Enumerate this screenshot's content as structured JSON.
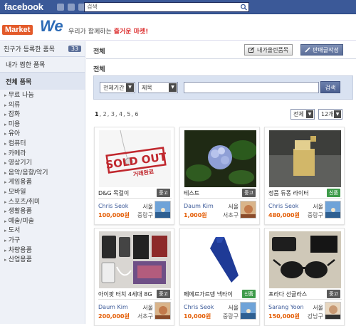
{
  "facebook": {
    "logo": "facebook",
    "search_placeholder": "검색"
  },
  "brand": {
    "market": "Market",
    "we": "We",
    "slogan_prefix": "우리가 함께하는 ",
    "slogan_highlight": "즐거운 마켓!"
  },
  "sidebar": {
    "friends_label": "친구가 등록한 품목",
    "friends_count": "33",
    "my_liked": "내가 찜한 품목",
    "all_items": "전체 품목",
    "categories": [
      "무료 나눔",
      "의류",
      "잡화",
      "미용",
      "유아",
      "컴퓨터",
      "카메라",
      "영상기기",
      "음악/음향/악기",
      "게임용품",
      "모바일",
      "스포츠/취미",
      "생활용품",
      "예술/미술",
      "도서",
      "가구",
      "차량용품",
      "산업용품"
    ]
  },
  "main": {
    "title": "전체",
    "btn_my_items": "내가올린품목",
    "btn_sell": "판매글작성",
    "section": "전체",
    "filter": {
      "period": "전체기간",
      "field": "제목",
      "search_button": "검색"
    },
    "pages": [
      "1",
      "2",
      "3",
      "4",
      "5",
      "6"
    ],
    "sort": "전체",
    "per_page": "12개"
  },
  "products": [
    {
      "name": "D&G 목걸이",
      "condition": "중고",
      "seller": "Chris Seok",
      "price": "100,000원",
      "city": "서울",
      "district": "중랑구",
      "sold_text": "SOLD OUT",
      "sold_sub": "거래완료"
    },
    {
      "name": "테스트",
      "condition": "중고",
      "seller": "Daum Kim",
      "price": "1,000원",
      "city": "서울",
      "district": "서초구"
    },
    {
      "name": "정품 듀퐁 라이터",
      "condition": "신품",
      "seller": "Chris Seok",
      "price": "480,000원",
      "city": "서울",
      "district": "중랑구"
    },
    {
      "name": "아이팟 터치 4세대 8G",
      "condition": "중고",
      "seller": "Daum Kim",
      "price": "200,000원",
      "city": "서울",
      "district": "서초구"
    },
    {
      "name": "페에르가르뎅 넥타이",
      "condition": "신품",
      "seller": "Chris Seok",
      "price": "10,000원",
      "city": "서울",
      "district": "중랑구"
    },
    {
      "name": "프라다 선글라스",
      "condition": "중고",
      "seller": "Sarang Yoon",
      "price": "150,000원",
      "city": "서울",
      "district": "강남구"
    }
  ],
  "colors": {
    "facebook_blue": "#3b5998",
    "price": "#e35a00",
    "used_badge": "#5a5a5a",
    "new_badge": "#3e9b4a"
  }
}
